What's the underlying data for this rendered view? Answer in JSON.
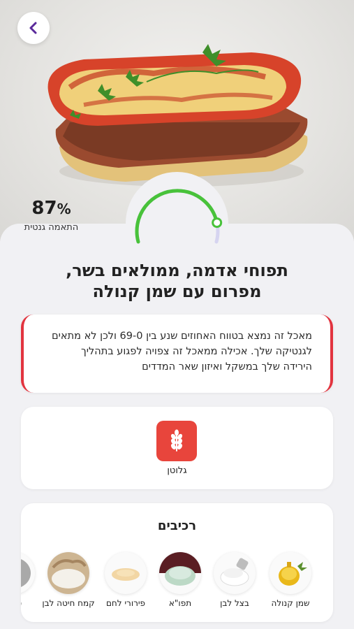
{
  "match": {
    "percent_number": "87",
    "percent_sign": "%",
    "percent_value": 87,
    "label": "התאמה גנטית",
    "colors": {
      "progress": "#48c23a",
      "track": "#d6d4f0"
    }
  },
  "dish": {
    "title_line1": "תפוחי אדמה, ממולאים בשר,",
    "title_line2": "מפרום עם שמן קנולה"
  },
  "warning": {
    "line1": "מאכל זה נמצא בטווח האחוזים שנע בין 69-0 ולכן לא מתאים",
    "line2": "לגנטיקה שלך. אכילה ממאכל זה  צפויה לפגוע בתהליך",
    "line3": "הירידה שלך במשקל ואיזון שאר המדדים",
    "accent": "#e2343f"
  },
  "allergens": [
    {
      "label": "גלוטן",
      "icon": "wheat-icon",
      "color": "#e8453c"
    }
  ],
  "ingredients": {
    "title": "רכיבים",
    "items": [
      {
        "label": "שמן קנולה",
        "icon": "oil-icon"
      },
      {
        "label": "בצל לבן",
        "icon": "salt-icon"
      },
      {
        "label": "תפו\"א",
        "icon": "potato-icon"
      },
      {
        "label": "פירורי לחם",
        "icon": "breadcrumbs-icon"
      },
      {
        "label": "קמח חיטה לבן",
        "icon": "flour-icon"
      },
      {
        "label": "טחון",
        "icon": "ground-meat-icon"
      }
    ]
  },
  "nav": {
    "back_icon": "chevron-left-icon",
    "accent": "#5a2a9a"
  }
}
